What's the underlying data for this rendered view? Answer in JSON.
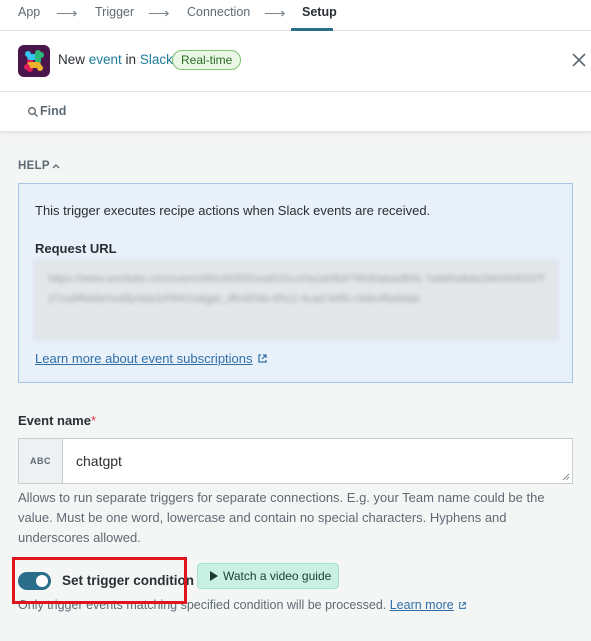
{
  "stepper": {
    "steps": [
      "App",
      "Trigger",
      "Connection",
      "Setup"
    ],
    "active_index": 3
  },
  "header": {
    "prefix": "New ",
    "event_word": "event",
    "mid": " in ",
    "app_name": "Slack",
    "badge": "Real-time"
  },
  "find": {
    "label": "Find"
  },
  "help": {
    "toggle_label": "HELP",
    "description": "This trigger executes recipe actions when Slack events are received.",
    "request_url_label": "Request URL",
    "request_url_value": "https://www.workato.com/users/981463f2f1ea61f1cc0a2a0fb6796d0abadfbfa 7a9d0a8ab2b6d4062d7f27ca8f6e6e/notify/slack/f4f4chatgpt_df04f09e-85c2-4cad-b9fb-c9de4fbefdab",
    "learn_link": "Learn more about event subscriptions"
  },
  "event_name": {
    "label": "Event name",
    "required_mark": "*",
    "type_tag": "ABC",
    "value": "chatgpt",
    "help": "Allows to run separate triggers for separate connections. E.g. your Team name could be the value. Must be one word, lowercase and contain no special characters. Hyphens and underscores allowed."
  },
  "condition": {
    "enabled": true,
    "label": "Set trigger condition",
    "video_button": "Watch a video guide",
    "help": "Only trigger events matching specified condition will be processed.",
    "learn_more": "Learn more"
  },
  "colors": {
    "accent": "#2b6e8c",
    "badge_green": "#7cc36f",
    "link": "#2f6fa7",
    "highlight_red": "#e0141c",
    "slack_purple": "#4a154b"
  }
}
